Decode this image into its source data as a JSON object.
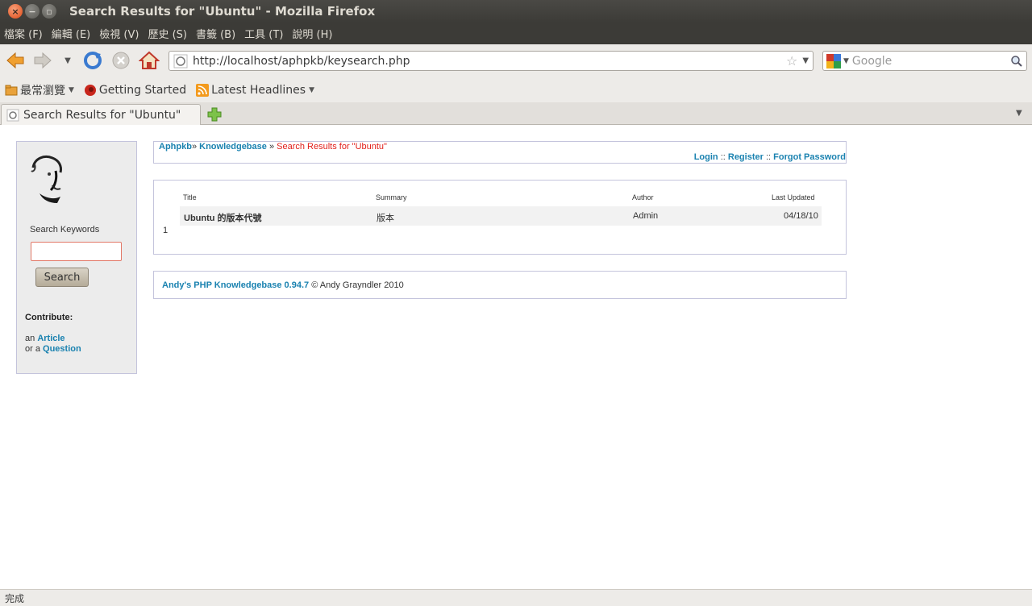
{
  "window": {
    "title": "Search Results for \"Ubuntu\" - Mozilla Firefox"
  },
  "menu": [
    {
      "label": "檔案 (F)"
    },
    {
      "label": "編輯 (E)"
    },
    {
      "label": "檢視 (V)"
    },
    {
      "label": "歷史 (S)"
    },
    {
      "label": "書籤 (B)"
    },
    {
      "label": "工具 (T)"
    },
    {
      "label": "說明 (H)"
    }
  ],
  "nav": {
    "url": "http://localhost/aphpkb/keysearch.php",
    "search_placeholder": "Google",
    "search_engine_icon": "google-icon"
  },
  "bookmarks": [
    {
      "label": "最常瀏覽",
      "icon": "folder-icon"
    },
    {
      "label": "Getting Started",
      "icon": "firefox-icon"
    },
    {
      "label": "Latest Headlines",
      "icon": "rss-icon"
    }
  ],
  "tab": {
    "title": "Search Results for \"Ubuntu\""
  },
  "sidebar": {
    "search_label": "Search Keywords",
    "search_value": "",
    "search_button": "Search",
    "contribute": "Contribute:",
    "line1_prefix": "an",
    "line1_link": "Article",
    "line2_prefix": "or a",
    "line2_link": "Question"
  },
  "breadcrumb": {
    "home": "Aphpkb",
    "sep1": "»",
    "kb": "Knowledgebase",
    "sep2": "»",
    "current": "Search Results for \"Ubuntu\""
  },
  "auth": {
    "login": "Login",
    "sep": "::",
    "register": "Register",
    "forgot": "Forgot Password"
  },
  "results": {
    "headers": {
      "title": "Title",
      "summary": "Summary",
      "author": "Author",
      "updated": "Last Updated"
    },
    "rows": [
      {
        "title": "Ubuntu 的版本代號",
        "summary": "版本",
        "author": "Admin",
        "updated": "04/18/10"
      }
    ],
    "page": "1"
  },
  "footer": {
    "product": "Andy's PHP Knowledgebase 0.94.7",
    "copyright": "© Andy Grayndler 2010"
  },
  "status": {
    "text": "完成"
  }
}
